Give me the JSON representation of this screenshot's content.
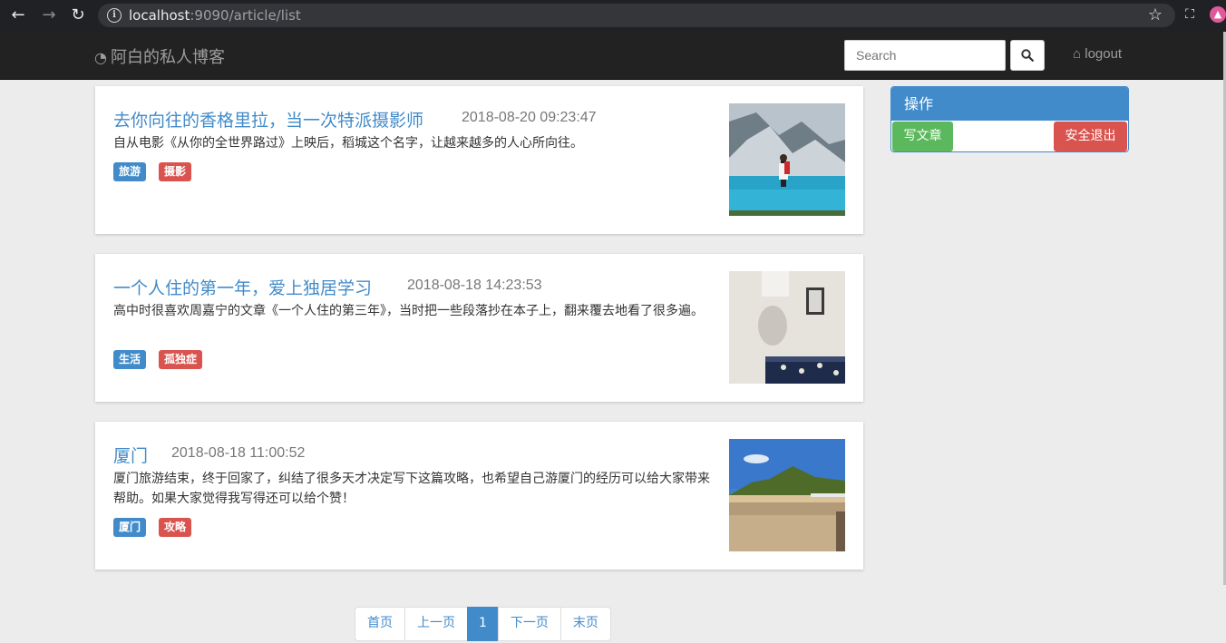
{
  "browser": {
    "url_host": "localhost",
    "url_rest": ":9090/article/list"
  },
  "navbar": {
    "brand": "阿白的私人博客",
    "search_placeholder": "Search",
    "logout": "logout"
  },
  "articles": [
    {
      "title": "去你向往的香格里拉，当一次特派摄影师",
      "time": "2018-08-20 09:23:47",
      "summary": "自从电影《从你的全世界路过》上映后，稻城这个名字，让越来越多的人心所向往。",
      "tags": [
        "旅游",
        "摄影"
      ]
    },
    {
      "title": "一个人住的第一年，爱上独居学习",
      "time": "2018-08-18 14:23:53",
      "summary": "高中时很喜欢周嘉宁的文章《一个人住的第三年》，当时把一些段落抄在本子上，翻来覆去地看了很多遍。",
      "tags": [
        "生活",
        "孤独症"
      ]
    },
    {
      "title": "厦门",
      "time": "2018-08-18 11:00:52",
      "summary": " 厦门旅游结束，终于回家了，纠结了很多天才决定写下这篇攻略，也希望自己游厦门的经历可以给大家带来帮助。如果大家觉得我写得还可以给个赞！",
      "tags": [
        "厦门",
        "攻略"
      ]
    }
  ],
  "sidebar": {
    "heading": "操作",
    "write": "写文章",
    "quit": "安全退出"
  },
  "pagination": {
    "first": "首页",
    "prev": "上一页",
    "current": "1",
    "next": "下一页",
    "last": "末页"
  },
  "colors": {
    "primary": "#428bca",
    "success": "#5cb85c",
    "danger": "#d9534f",
    "navbar": "#222222"
  }
}
